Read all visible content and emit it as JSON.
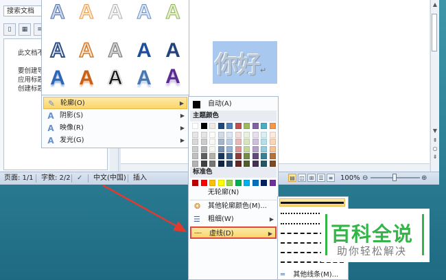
{
  "nav": {
    "search_placeholder": "搜索文档",
    "lines": [
      "此文档不",
      "要创建导",
      "应用标题",
      "创建标题"
    ]
  },
  "document": {
    "wordart_text": "你好",
    "para_mark": "↵"
  },
  "status_bar": {
    "page": "页面: 1/1",
    "words": "字数: 2/2",
    "language": "中文(中国)",
    "mode": "插入",
    "zoom": "100%"
  },
  "effects_menu": {
    "items": [
      {
        "label": "轮廓(O)",
        "icon": "pen-outline-icon"
      },
      {
        "label": "阴影(S)",
        "icon": "shadow-a-icon"
      },
      {
        "label": "映像(R)",
        "icon": "reflection-a-icon"
      },
      {
        "label": "发光(G)",
        "icon": "glow-a-icon"
      }
    ]
  },
  "outline_menu": {
    "auto": "自动(A)",
    "theme_colors_header": "主题颜色",
    "standard_colors_header": "标准色",
    "no_outline": "无轮廓(N)",
    "more_colors": "其他轮廓颜色(M)...",
    "weight": "粗细(W)",
    "dashes": "虚线(D)",
    "theme_top": [
      "#ffffff",
      "#000000",
      "#eeece1",
      "#1f497d",
      "#4f81bd",
      "#c0504d",
      "#9bbb59",
      "#8064a2",
      "#4bacc6",
      "#f79646"
    ],
    "standard": [
      "#c00000",
      "#ff0000",
      "#ffc000",
      "#ffff00",
      "#92d050",
      "#00b050",
      "#00b0f0",
      "#0070c0",
      "#002060",
      "#7030a0"
    ]
  },
  "dash_menu": {
    "more_lines": "其他线条(M)..."
  },
  "watermark": {
    "line1": "百科全说",
    "line2": "助你轻松解决"
  }
}
